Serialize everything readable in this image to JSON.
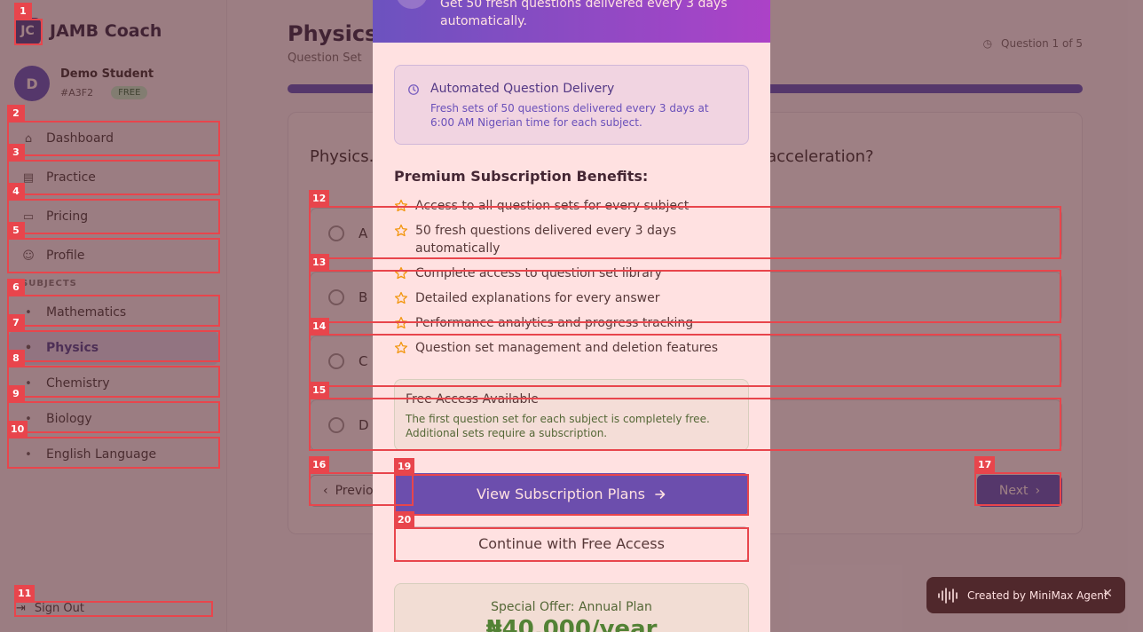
{
  "app": {
    "brand_logo": "JC",
    "brand_name": "JAMB Coach",
    "user": {
      "initial": "D",
      "name": "Demo Student",
      "id": "#A3F2",
      "badge": "FREE"
    }
  },
  "sidebar": {
    "items": [
      {
        "label": "Dashboard",
        "icon": "home-icon"
      },
      {
        "label": "Practice",
        "icon": "book-icon"
      },
      {
        "label": "Pricing",
        "icon": "card-icon"
      },
      {
        "label": "Profile",
        "icon": "user-icon"
      }
    ],
    "section_label": "SUBJECTS",
    "subjects": [
      {
        "label": "Mathematics"
      },
      {
        "label": "Physics"
      },
      {
        "label": "Chemistry"
      },
      {
        "label": "Biology"
      },
      {
        "label": "English Language"
      }
    ],
    "signout_label": "Sign Out"
  },
  "main": {
    "title": "Physics",
    "subtitle": "Question Set",
    "progress_label": "Question 1 of 5",
    "progress_fraction": 1.0,
    "question": "Physics... a body moves with velocity 12 m/s. What is its acceleration?",
    "options": [
      {
        "letter": "A"
      },
      {
        "letter": "B"
      },
      {
        "letter": "C"
      },
      {
        "letter": "D"
      }
    ],
    "prev_label": "Previous",
    "next_label": "Next"
  },
  "modal": {
    "header_text": "Get 50 fresh questions delivered every 3 days automatically.",
    "auto_title": "Automated Question Delivery",
    "auto_text": "Fresh sets of 50 questions delivered every 3 days at 6:00 AM Nigerian time for each subject.",
    "benefits_title": "Premium Subscription Benefits:",
    "benefits": [
      "Access to all question sets for every subject",
      "50 fresh questions delivered every 3 days automatically",
      "Complete access to question set library",
      "Detailed explanations for every answer",
      "Performance analytics and progress tracking",
      "Question set management and deletion features"
    ],
    "free_title": "Free Access Available",
    "free_text": "The first question set for each subject is completely free. Additional sets require a subscription.",
    "plans_button": "View Subscription Plans",
    "free_button": "Continue with Free Access",
    "offer_title": "Special Offer: Annual Plan",
    "offer_price": "₦40,000/year"
  },
  "toast": {
    "text": "Created by MiniMax Agent"
  },
  "annotations": [
    "1",
    "2",
    "3",
    "4",
    "5",
    "6",
    "7",
    "8",
    "9",
    "10",
    "11",
    "12",
    "13",
    "14",
    "15",
    "16",
    "17",
    "19",
    "20"
  ],
  "colors": {
    "accent": "#4c4cc0",
    "annotation": "#e8454c",
    "gradient_start": "#4c52d6",
    "gradient_end": "#9a3ee0"
  }
}
